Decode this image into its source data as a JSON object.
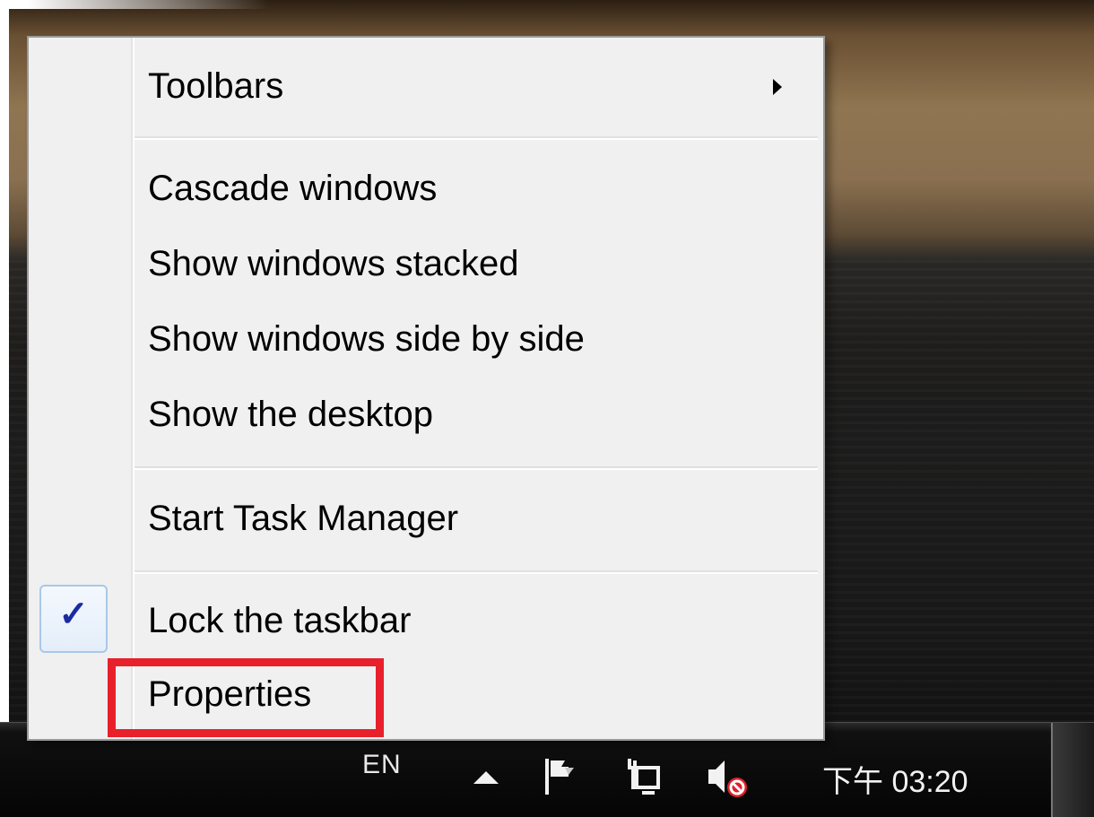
{
  "menu": {
    "items": [
      {
        "label": "Toolbars",
        "has_submenu": true
      },
      {
        "label": "Cascade windows"
      },
      {
        "label": "Show windows stacked"
      },
      {
        "label": "Show windows side by side"
      },
      {
        "label": "Show the desktop"
      },
      {
        "label": "Start Task Manager"
      },
      {
        "label": "Lock the taskbar",
        "checked": true
      },
      {
        "label": "Properties",
        "highlighted": true
      }
    ],
    "check_glyph": "✓"
  },
  "taskbar": {
    "language": "EN",
    "clock": "下午 03:20",
    "tray_icons": [
      "show-hidden-icons-arrow",
      "action-center-flag-icon",
      "network-icon",
      "volume-muted-icon"
    ]
  },
  "colors": {
    "menu_background": "#f0f0f0",
    "highlight_box": "#e8202c",
    "checkmark": "#1a2ca0"
  }
}
